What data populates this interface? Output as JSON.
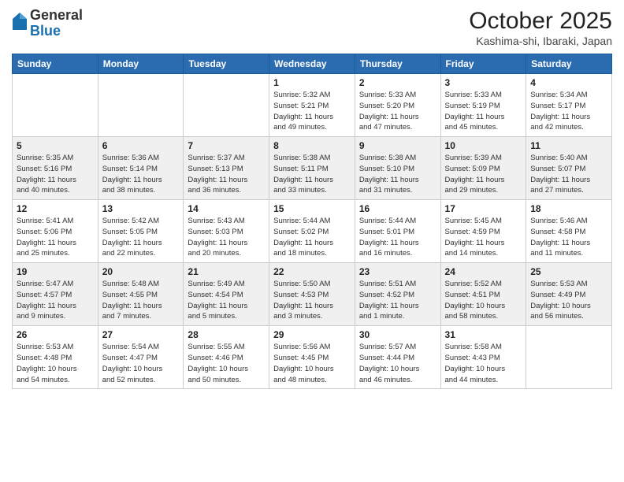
{
  "header": {
    "logo_general": "General",
    "logo_blue": "Blue",
    "month_title": "October 2025",
    "location": "Kashima-shi, Ibaraki, Japan"
  },
  "days_of_week": [
    "Sunday",
    "Monday",
    "Tuesday",
    "Wednesday",
    "Thursday",
    "Friday",
    "Saturday"
  ],
  "weeks": [
    [
      {
        "day": "",
        "info": ""
      },
      {
        "day": "",
        "info": ""
      },
      {
        "day": "",
        "info": ""
      },
      {
        "day": "1",
        "info": "Sunrise: 5:32 AM\nSunset: 5:21 PM\nDaylight: 11 hours\nand 49 minutes."
      },
      {
        "day": "2",
        "info": "Sunrise: 5:33 AM\nSunset: 5:20 PM\nDaylight: 11 hours\nand 47 minutes."
      },
      {
        "day": "3",
        "info": "Sunrise: 5:33 AM\nSunset: 5:19 PM\nDaylight: 11 hours\nand 45 minutes."
      },
      {
        "day": "4",
        "info": "Sunrise: 5:34 AM\nSunset: 5:17 PM\nDaylight: 11 hours\nand 42 minutes."
      }
    ],
    [
      {
        "day": "5",
        "info": "Sunrise: 5:35 AM\nSunset: 5:16 PM\nDaylight: 11 hours\nand 40 minutes."
      },
      {
        "day": "6",
        "info": "Sunrise: 5:36 AM\nSunset: 5:14 PM\nDaylight: 11 hours\nand 38 minutes."
      },
      {
        "day": "7",
        "info": "Sunrise: 5:37 AM\nSunset: 5:13 PM\nDaylight: 11 hours\nand 36 minutes."
      },
      {
        "day": "8",
        "info": "Sunrise: 5:38 AM\nSunset: 5:11 PM\nDaylight: 11 hours\nand 33 minutes."
      },
      {
        "day": "9",
        "info": "Sunrise: 5:38 AM\nSunset: 5:10 PM\nDaylight: 11 hours\nand 31 minutes."
      },
      {
        "day": "10",
        "info": "Sunrise: 5:39 AM\nSunset: 5:09 PM\nDaylight: 11 hours\nand 29 minutes."
      },
      {
        "day": "11",
        "info": "Sunrise: 5:40 AM\nSunset: 5:07 PM\nDaylight: 11 hours\nand 27 minutes."
      }
    ],
    [
      {
        "day": "12",
        "info": "Sunrise: 5:41 AM\nSunset: 5:06 PM\nDaylight: 11 hours\nand 25 minutes."
      },
      {
        "day": "13",
        "info": "Sunrise: 5:42 AM\nSunset: 5:05 PM\nDaylight: 11 hours\nand 22 minutes."
      },
      {
        "day": "14",
        "info": "Sunrise: 5:43 AM\nSunset: 5:03 PM\nDaylight: 11 hours\nand 20 minutes."
      },
      {
        "day": "15",
        "info": "Sunrise: 5:44 AM\nSunset: 5:02 PM\nDaylight: 11 hours\nand 18 minutes."
      },
      {
        "day": "16",
        "info": "Sunrise: 5:44 AM\nSunset: 5:01 PM\nDaylight: 11 hours\nand 16 minutes."
      },
      {
        "day": "17",
        "info": "Sunrise: 5:45 AM\nSunset: 4:59 PM\nDaylight: 11 hours\nand 14 minutes."
      },
      {
        "day": "18",
        "info": "Sunrise: 5:46 AM\nSunset: 4:58 PM\nDaylight: 11 hours\nand 11 minutes."
      }
    ],
    [
      {
        "day": "19",
        "info": "Sunrise: 5:47 AM\nSunset: 4:57 PM\nDaylight: 11 hours\nand 9 minutes."
      },
      {
        "day": "20",
        "info": "Sunrise: 5:48 AM\nSunset: 4:55 PM\nDaylight: 11 hours\nand 7 minutes."
      },
      {
        "day": "21",
        "info": "Sunrise: 5:49 AM\nSunset: 4:54 PM\nDaylight: 11 hours\nand 5 minutes."
      },
      {
        "day": "22",
        "info": "Sunrise: 5:50 AM\nSunset: 4:53 PM\nDaylight: 11 hours\nand 3 minutes."
      },
      {
        "day": "23",
        "info": "Sunrise: 5:51 AM\nSunset: 4:52 PM\nDaylight: 11 hours\nand 1 minute."
      },
      {
        "day": "24",
        "info": "Sunrise: 5:52 AM\nSunset: 4:51 PM\nDaylight: 10 hours\nand 58 minutes."
      },
      {
        "day": "25",
        "info": "Sunrise: 5:53 AM\nSunset: 4:49 PM\nDaylight: 10 hours\nand 56 minutes."
      }
    ],
    [
      {
        "day": "26",
        "info": "Sunrise: 5:53 AM\nSunset: 4:48 PM\nDaylight: 10 hours\nand 54 minutes."
      },
      {
        "day": "27",
        "info": "Sunrise: 5:54 AM\nSunset: 4:47 PM\nDaylight: 10 hours\nand 52 minutes."
      },
      {
        "day": "28",
        "info": "Sunrise: 5:55 AM\nSunset: 4:46 PM\nDaylight: 10 hours\nand 50 minutes."
      },
      {
        "day": "29",
        "info": "Sunrise: 5:56 AM\nSunset: 4:45 PM\nDaylight: 10 hours\nand 48 minutes."
      },
      {
        "day": "30",
        "info": "Sunrise: 5:57 AM\nSunset: 4:44 PM\nDaylight: 10 hours\nand 46 minutes."
      },
      {
        "day": "31",
        "info": "Sunrise: 5:58 AM\nSunset: 4:43 PM\nDaylight: 10 hours\nand 44 minutes."
      },
      {
        "day": "",
        "info": ""
      }
    ]
  ]
}
